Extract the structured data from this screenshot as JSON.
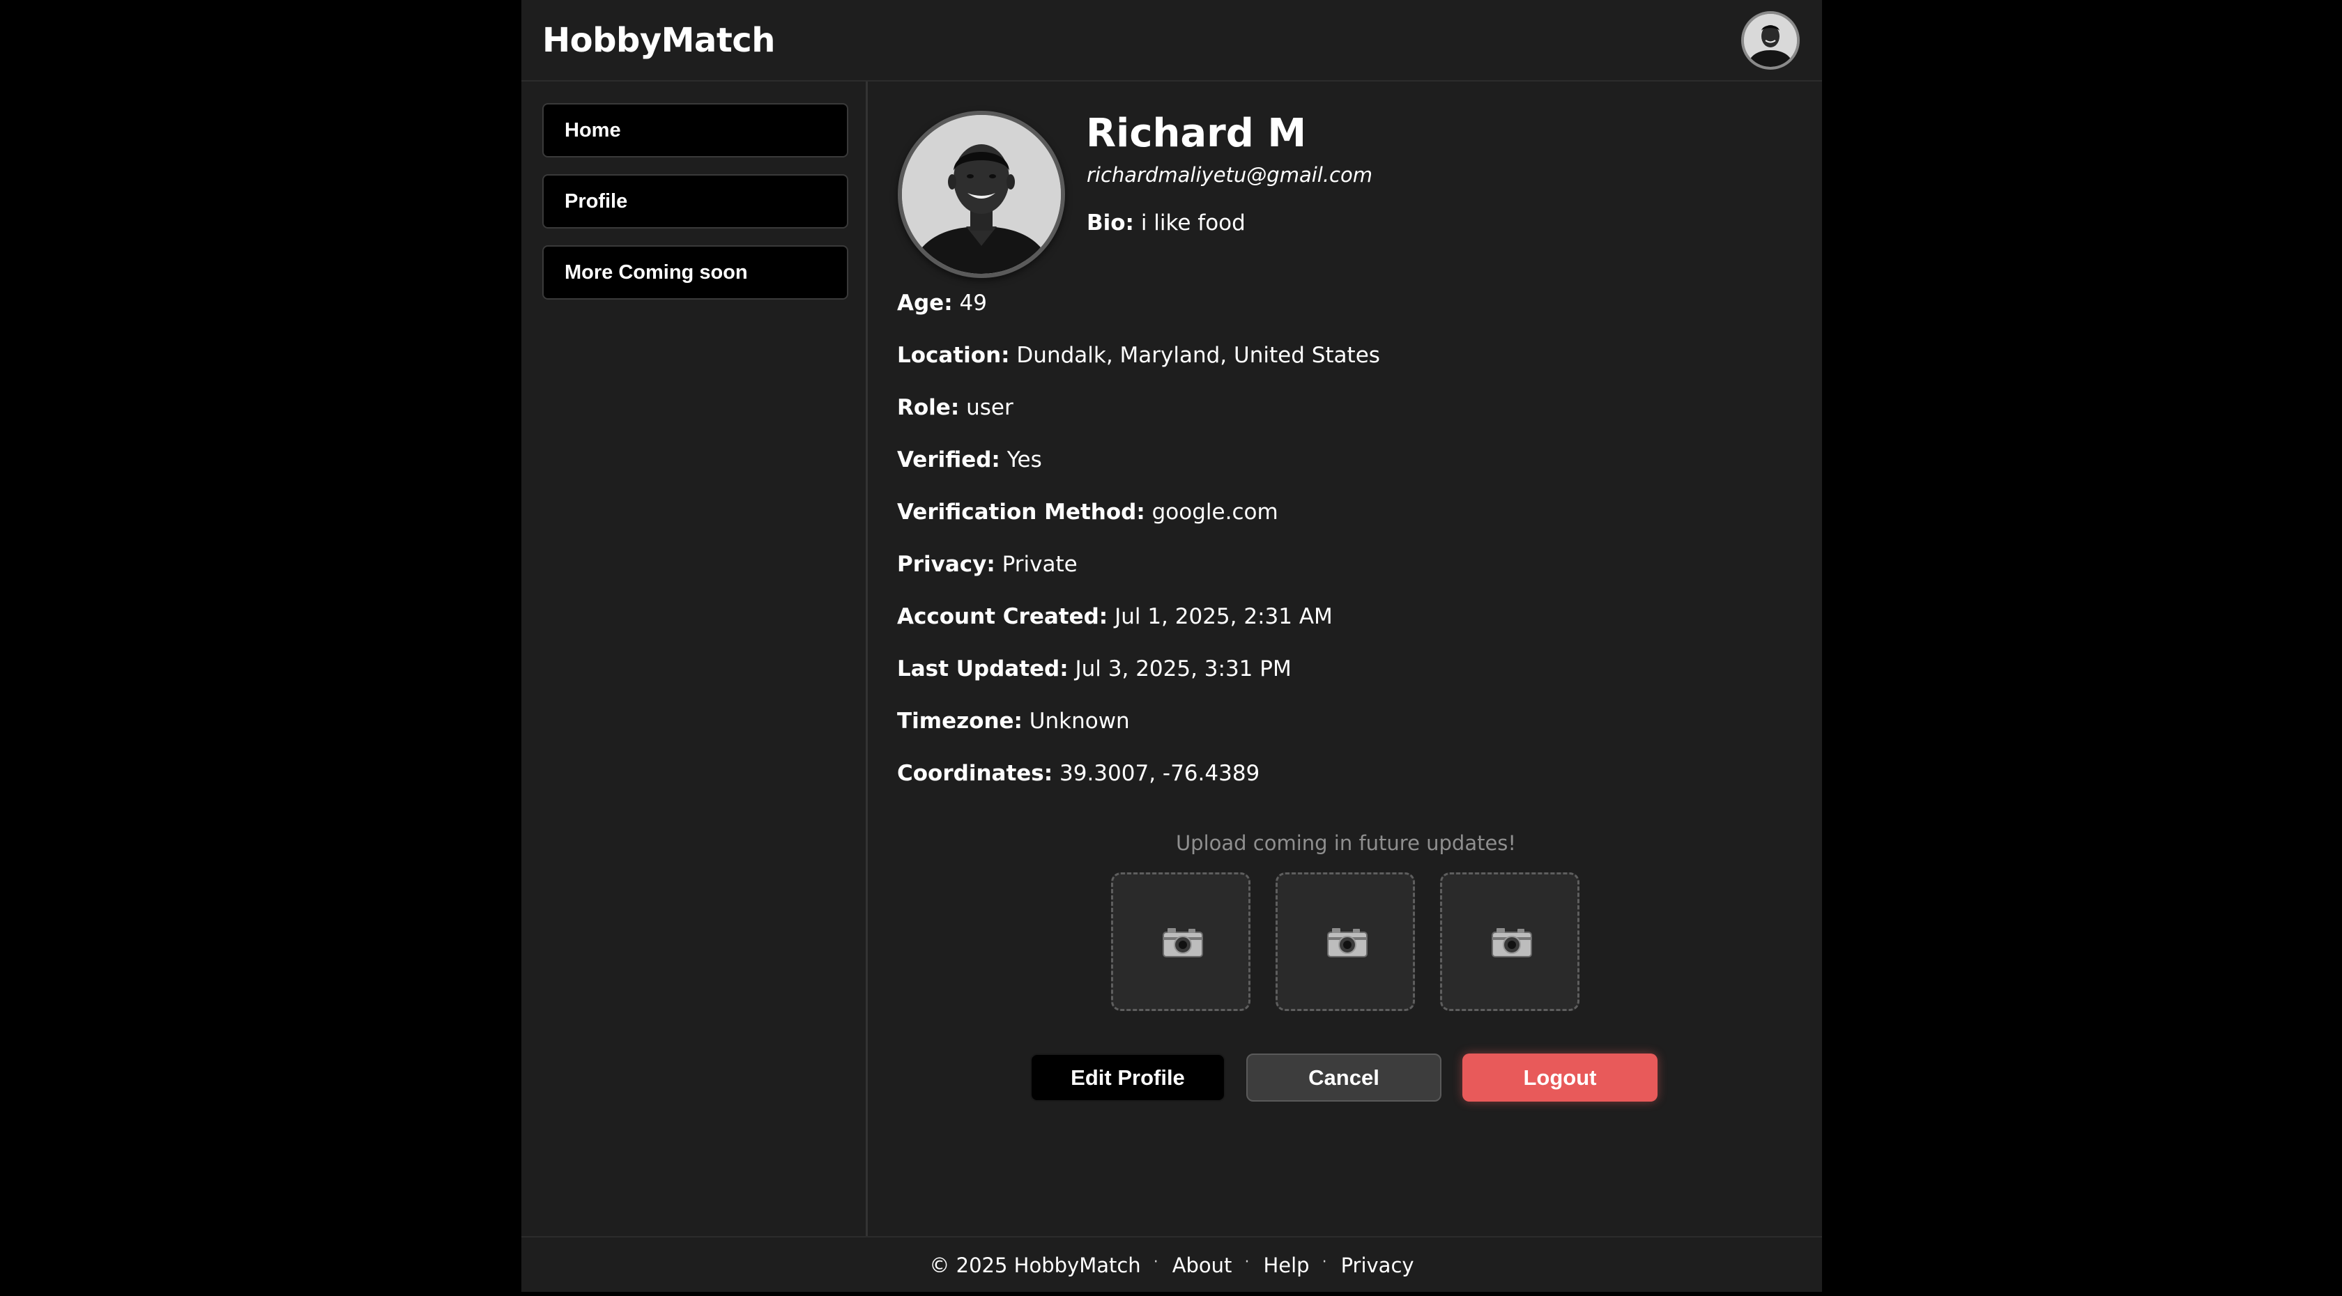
{
  "header": {
    "brand": "HobbyMatch"
  },
  "sidebar": {
    "items": [
      {
        "label": "Home"
      },
      {
        "label": "Profile"
      },
      {
        "label": "More Coming soon"
      }
    ]
  },
  "profile": {
    "name": "Richard M",
    "email": "richardmaliyetu@gmail.com",
    "bio_label": "Bio:",
    "bio": "i like food",
    "fields": [
      {
        "label": "Age:",
        "value": "49"
      },
      {
        "label": "Location:",
        "value": "Dundalk, Maryland, United States"
      },
      {
        "label": "Role:",
        "value": "user"
      },
      {
        "label": "Verified:",
        "value": "Yes"
      },
      {
        "label": "Verification Method:",
        "value": "google.com"
      },
      {
        "label": "Privacy:",
        "value": "Private"
      },
      {
        "label": "Account Created:",
        "value": "Jul 1, 2025, 2:31 AM"
      },
      {
        "label": "Last Updated:",
        "value": "Jul 3, 2025, 3:31 PM"
      },
      {
        "label": "Timezone:",
        "value": "Unknown"
      },
      {
        "label": "Coordinates:",
        "value": "39.3007, -76.4389"
      }
    ]
  },
  "uploads": {
    "note": "Upload coming in future updates!",
    "slot_icon": "camera-icon"
  },
  "actions": {
    "edit_label": "Edit Profile",
    "cancel_label": "Cancel",
    "logout_label": "Logout"
  },
  "footer": {
    "copyright": "© 2025 HobbyMatch",
    "links": [
      "About",
      "Help",
      "Privacy"
    ],
    "separator": "·"
  },
  "colors": {
    "background": "#000000",
    "panel": "#1e1e1e",
    "logout": "#e85a5a",
    "muted_text": "#8f8f8f"
  }
}
